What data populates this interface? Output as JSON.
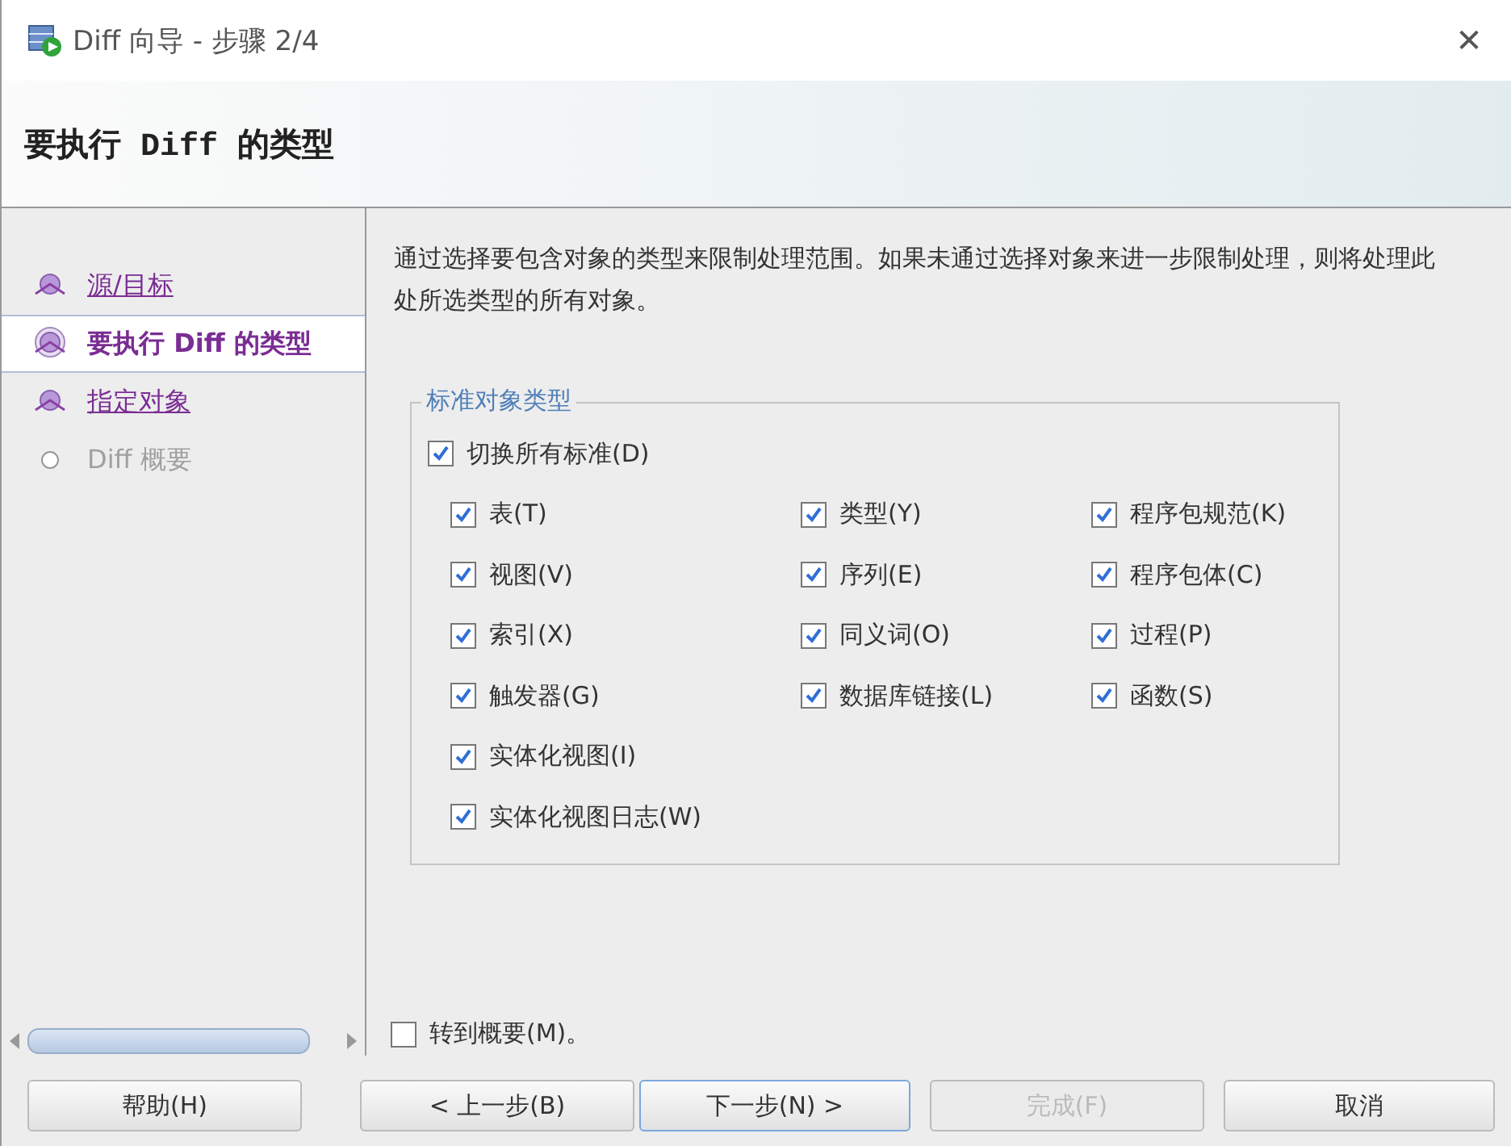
{
  "window": {
    "title": "Diff 向导 - 步骤 2/4",
    "close": "✕"
  },
  "header": {
    "title": "要执行 Diff 的类型"
  },
  "steps": [
    {
      "label": "源/目标",
      "kind": "done",
      "selected": false
    },
    {
      "label": "要执行 Diff 的类型",
      "kind": "current",
      "selected": true
    },
    {
      "label": "指定对象",
      "kind": "done",
      "selected": false
    },
    {
      "label": "Diff 概要",
      "kind": "todo",
      "selected": false
    }
  ],
  "description": "通过选择要包含对象的类型来限制处理范围。如果未通过选择对象来进一步限制处理，则将处理此处所选类型的所有对象。",
  "group": {
    "title": "标准对象类型",
    "toggle_all": {
      "label": "切换所有标准(D)",
      "checked": true
    },
    "rows": [
      [
        {
          "label": "表(T)",
          "checked": true
        },
        {
          "label": "类型(Y)",
          "checked": true
        },
        {
          "label": "程序包规范(K)",
          "checked": true
        }
      ],
      [
        {
          "label": "视图(V)",
          "checked": true
        },
        {
          "label": "序列(E)",
          "checked": true
        },
        {
          "label": "程序包体(C)",
          "checked": true
        }
      ],
      [
        {
          "label": "索引(X)",
          "checked": true
        },
        {
          "label": "同义词(O)",
          "checked": true
        },
        {
          "label": "过程(P)",
          "checked": true
        }
      ],
      [
        {
          "label": "触发器(G)",
          "checked": true
        },
        {
          "label": "数据库链接(L)",
          "checked": true
        },
        {
          "label": "函数(S)",
          "checked": true
        }
      ],
      [
        {
          "label": "实体化视图(I)",
          "checked": true
        }
      ],
      [
        {
          "label": "实体化视图日志(W)",
          "checked": true
        }
      ]
    ]
  },
  "goto_summary": {
    "label": "转到概要(M)。",
    "checked": false
  },
  "buttons": [
    {
      "label": "帮助(H)",
      "disabled": false,
      "focused": false
    },
    {
      "label": "< 上一步(B)",
      "disabled": false,
      "focused": false
    },
    {
      "label": "下一步(N) >",
      "disabled": false,
      "focused": true
    },
    {
      "label": "完成(F)",
      "disabled": true,
      "focused": false
    },
    {
      "label": "取消",
      "disabled": false,
      "focused": false
    }
  ]
}
